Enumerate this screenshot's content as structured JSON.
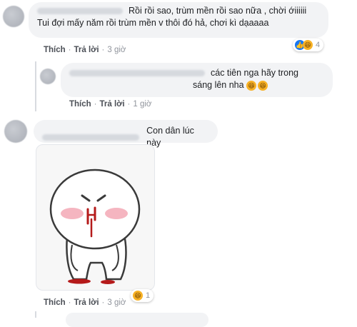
{
  "comments": [
    {
      "line1": "Rồi rồi sao, trùm mền rồi sao nữa , chời ớiiiiii",
      "line2": "Tui đợi mấy năm rồi trùm mền v thôi đó hả, chơi kì dạaaaa",
      "actions": {
        "like": "Thích",
        "reply": "Trả lời",
        "time": "3 giờ"
      },
      "reaction_count": "4"
    },
    {
      "line1": "các tiên nga hãy trong",
      "line2": "sáng lên nha",
      "actions": {
        "like": "Thích",
        "reply": "Trả lời",
        "time": "1 giờ"
      }
    },
    {
      "text": "Con dân lúc này",
      "actions": {
        "like": "Thích",
        "reply": "Trả lời",
        "time": "3 giờ"
      },
      "reaction_count": "1"
    }
  ],
  "icons": {
    "like": "like-icon",
    "haha": "haha-icon",
    "sticker": "crying-blob-sticker"
  },
  "colors": {
    "bubble": "#f2f3f5",
    "link": "#4b4f56",
    "like_blue": "#1877f2",
    "haha_yellow": "#f7b125"
  }
}
